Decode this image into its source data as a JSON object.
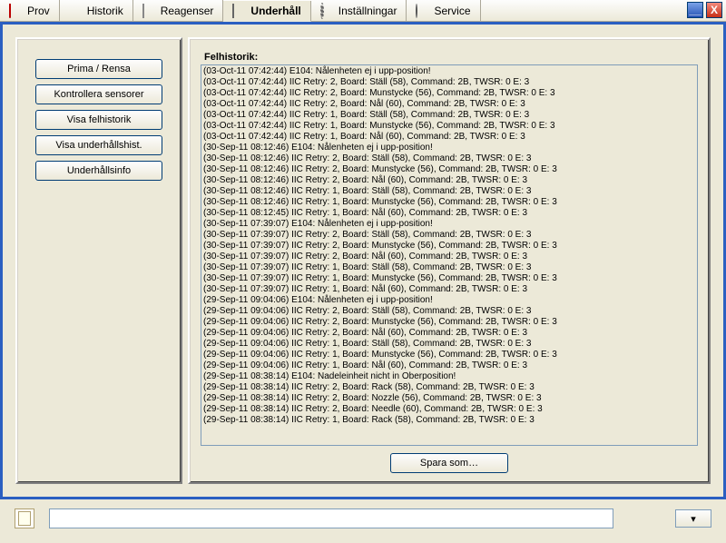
{
  "tabs": [
    {
      "label": "Prov",
      "icon": "tube-icon"
    },
    {
      "label": "Historik",
      "icon": "bars-icon"
    },
    {
      "label": "Reagenser",
      "icon": "doc-icon"
    },
    {
      "label": "Underhåll",
      "icon": "box-icon",
      "active": true
    },
    {
      "label": "Inställningar",
      "icon": "gear-icon"
    },
    {
      "label": "Service",
      "icon": "dot-icon"
    }
  ],
  "sidebar": {
    "buttons": [
      "Prima / Rensa",
      "Kontrollera sensorer",
      "Visa felhistorik",
      "Visa underhållshist.",
      "Underhållsinfo"
    ]
  },
  "main": {
    "log_label": "Felhistorik:",
    "save_label": "Spara som…",
    "log": [
      "(03-Oct-11 07:42:44) E104: Nålenheten ej i upp-position!",
      "(03-Oct-11 07:42:44) IIC Retry: 2, Board: Ställ (58), Command: 2B, TWSR: 0 E: 3",
      "(03-Oct-11 07:42:44) IIC Retry: 2, Board: Munstycke (56), Command: 2B, TWSR: 0 E: 3",
      "(03-Oct-11 07:42:44) IIC Retry: 2, Board: Nål (60), Command: 2B, TWSR: 0 E: 3",
      "(03-Oct-11 07:42:44) IIC Retry: 1, Board: Ställ (58), Command: 2B, TWSR: 0 E: 3",
      "(03-Oct-11 07:42:44) IIC Retry: 1, Board: Munstycke (56), Command: 2B, TWSR: 0 E: 3",
      "(03-Oct-11 07:42:44) IIC Retry: 1, Board: Nål (60), Command: 2B, TWSR: 0 E: 3",
      "(30-Sep-11 08:12:46) E104: Nålenheten ej i upp-position!",
      "(30-Sep-11 08:12:46) IIC Retry: 2, Board: Ställ (58), Command: 2B, TWSR: 0 E: 3",
      "(30-Sep-11 08:12:46) IIC Retry: 2, Board: Munstycke (56), Command: 2B, TWSR: 0 E: 3",
      "(30-Sep-11 08:12:46) IIC Retry: 2, Board: Nål (60), Command: 2B, TWSR: 0 E: 3",
      "(30-Sep-11 08:12:46) IIC Retry: 1, Board: Ställ (58), Command: 2B, TWSR: 0 E: 3",
      "(30-Sep-11 08:12:46) IIC Retry: 1, Board: Munstycke (56), Command: 2B, TWSR: 0 E: 3",
      "(30-Sep-11 08:12:45) IIC Retry: 1, Board: Nål (60), Command: 2B, TWSR: 0 E: 3",
      "(30-Sep-11 07:39:07) E104: Nålenheten ej i upp-position!",
      "(30-Sep-11 07:39:07) IIC Retry: 2, Board: Ställ (58), Command: 2B, TWSR: 0 E: 3",
      "(30-Sep-11 07:39:07) IIC Retry: 2, Board: Munstycke (56), Command: 2B, TWSR: 0 E: 3",
      "(30-Sep-11 07:39:07) IIC Retry: 2, Board: Nål (60), Command: 2B, TWSR: 0 E: 3",
      "(30-Sep-11 07:39:07) IIC Retry: 1, Board: Ställ (58), Command: 2B, TWSR: 0 E: 3",
      "(30-Sep-11 07:39:07) IIC Retry: 1, Board: Munstycke (56), Command: 2B, TWSR: 0 E: 3",
      "(30-Sep-11 07:39:07) IIC Retry: 1, Board: Nål (60), Command: 2B, TWSR: 0 E: 3",
      "(29-Sep-11 09:04:06) E104: Nålenheten ej i upp-position!",
      "(29-Sep-11 09:04:06) IIC Retry: 2, Board: Ställ (58), Command: 2B, TWSR: 0 E: 3",
      "(29-Sep-11 09:04:06) IIC Retry: 2, Board: Munstycke (56), Command: 2B, TWSR: 0 E: 3",
      "(29-Sep-11 09:04:06) IIC Retry: 2, Board: Nål (60), Command: 2B, TWSR: 0 E: 3",
      "(29-Sep-11 09:04:06) IIC Retry: 1, Board: Ställ (58), Command: 2B, TWSR: 0 E: 3",
      "(29-Sep-11 09:04:06) IIC Retry: 1, Board: Munstycke (56), Command: 2B, TWSR: 0 E: 3",
      "(29-Sep-11 09:04:06) IIC Retry: 1, Board: Nål (60), Command: 2B, TWSR: 0 E: 3",
      "(29-Sep-11 08:38:14) E104: Nadeleinheit nicht in Oberposition!",
      "(29-Sep-11 08:38:14) IIC Retry: 2, Board: Rack (58), Command: 2B, TWSR: 0 E: 3",
      "(29-Sep-11 08:38:14) IIC Retry: 2, Board: Nozzle (56), Command: 2B, TWSR: 0 E: 3",
      "(29-Sep-11 08:38:14) IIC Retry: 2, Board: Needle (60), Command: 2B, TWSR: 0 E: 3",
      "(29-Sep-11 08:38:14) IIC Retry: 1, Board: Rack (58), Command: 2B, TWSR: 0 E: 3"
    ]
  },
  "statusbar": {
    "value": ""
  }
}
